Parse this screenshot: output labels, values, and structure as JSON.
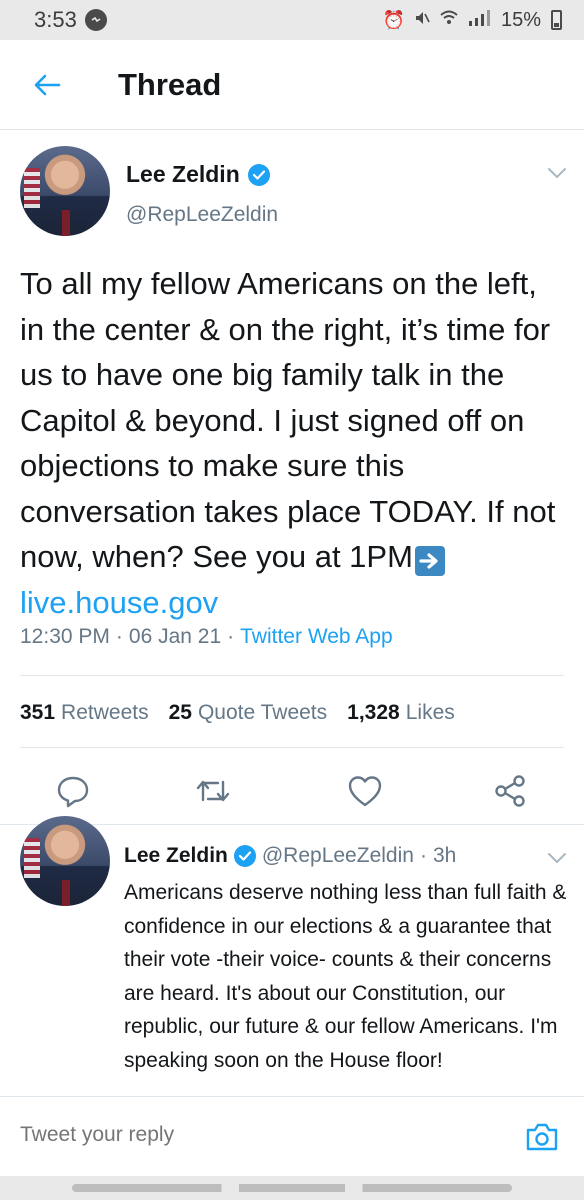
{
  "status_bar": {
    "time": "3:53",
    "battery": "15%"
  },
  "header": {
    "title": "Thread"
  },
  "main_tweet": {
    "author_name": "Lee Zeldin",
    "handle": "@RepLeeZeldin",
    "text_before_emoji": "To all my fellow Americans on the left, in the center & on the right, it’s time for us to have one big family talk in the Capitol & beyond. I just signed off on objections to make sure this conversation takes place TODAY. If not now, when? See you at 1PM",
    "link": "live.house.gov",
    "time": "12:30 PM",
    "date": "06 Jan 21",
    "source": "Twitter Web App",
    "separator": "·",
    "stats": {
      "retweets_count": "351",
      "retweets_label": "Retweets",
      "quotes_count": "25",
      "quotes_label": "Quote Tweets",
      "likes_count": "1,328",
      "likes_label": "Likes"
    }
  },
  "reply_tweet": {
    "author_name": "Lee Zeldin",
    "handle": "@RepLeeZeldin",
    "separator": "·",
    "age": "3h",
    "text": "Americans deserve nothing less than full faith & confidence in our elections & a guarantee that their vote -their voice- counts & their concerns are heard.  It's about our Constitution, our republic, our future & our fellow Americans. I'm speaking soon on the House floor!"
  },
  "reply_bar": {
    "placeholder": "Tweet your reply"
  },
  "colors": {
    "accent": "#1da1f2",
    "text_primary": "#14171a",
    "text_secondary": "#657786",
    "divider": "#e1e8ed"
  },
  "icons": [
    "message-icon",
    "alarm-icon",
    "mute-icon",
    "wifi-icon",
    "signal-icon",
    "battery-icon",
    "back-arrow-icon",
    "verified-badge-icon",
    "chevron-down-icon",
    "reply-icon",
    "retweet-icon",
    "like-icon",
    "share-icon",
    "camera-icon",
    "arrow-right-emoji-icon"
  ]
}
